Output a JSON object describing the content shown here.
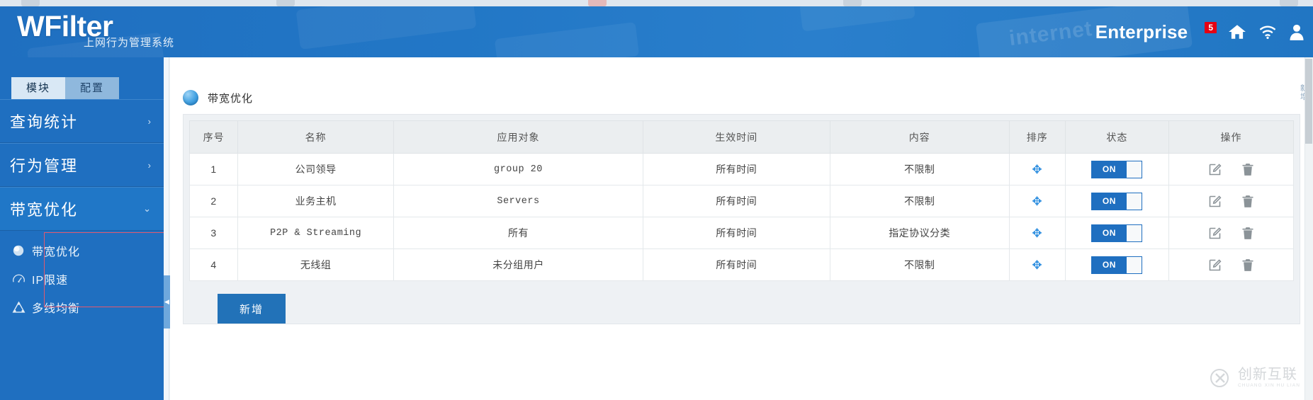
{
  "header": {
    "brand": "WFilter",
    "brand_sub": "上网行为管理系统",
    "edition": "Enterprise",
    "notification_count": "5",
    "keyboard_word": "internet",
    "icons": [
      "home-icon",
      "wifi-icon",
      "user-icon"
    ]
  },
  "sidebar": {
    "tabs": [
      {
        "label": "模块",
        "active": true
      },
      {
        "label": "配置",
        "active": false
      }
    ],
    "nav": [
      {
        "label": "查询统计",
        "chevron": "›",
        "open": false
      },
      {
        "label": "行为管理",
        "chevron": "›",
        "open": false
      },
      {
        "label": "带宽优化",
        "chevron": "⌄",
        "open": true
      }
    ],
    "submenu": [
      {
        "label": "带宽优化",
        "icon": "sphere-icon"
      },
      {
        "label": "IP限速",
        "icon": "gauge-icon"
      },
      {
        "label": "多线均衡",
        "icon": "balance-icon"
      }
    ],
    "highlight_color": "#e2596f"
  },
  "content": {
    "panel_title": "带宽优化",
    "collapse_handle": "◀",
    "cut_text": "新增",
    "table": {
      "headers": [
        "序号",
        "名称",
        "应用对象",
        "生效时间",
        "内容",
        "排序",
        "状态",
        "操作"
      ],
      "rows": [
        {
          "index": "1",
          "name": "公司领导",
          "target": "group 20",
          "target_mono": true,
          "time": "所有时间",
          "content": "不限制",
          "sort_icon": "move-icon",
          "status": "ON",
          "ops": [
            "edit-icon",
            "delete-icon"
          ]
        },
        {
          "index": "2",
          "name": "业务主机",
          "target": "Servers",
          "target_mono": true,
          "time": "所有时间",
          "content": "不限制",
          "sort_icon": "move-icon",
          "status": "ON",
          "ops": [
            "edit-icon",
            "delete-icon"
          ]
        },
        {
          "index": "3",
          "name": "P2P & Streaming",
          "target": "所有",
          "target_mono": false,
          "time": "所有时间",
          "content": "指定协议分类",
          "sort_icon": "move-icon",
          "status": "ON",
          "ops": [
            "edit-icon",
            "delete-icon"
          ]
        },
        {
          "index": "4",
          "name": "无线组",
          "target": "未分组用户",
          "target_mono": false,
          "time": "所有时间",
          "content": "不限制",
          "sort_icon": "move-icon",
          "status": "ON",
          "ops": [
            "edit-icon",
            "delete-icon"
          ]
        }
      ]
    },
    "add_button": "新增"
  },
  "watermark": {
    "main": "创新互联",
    "sub": "CHUANG XIN HU LIAN"
  },
  "colors": {
    "brand_blue": "#1f6fc0",
    "accent_blue": "#2272b8",
    "badge_red": "#e60012",
    "outline_red": "#e2596f"
  }
}
